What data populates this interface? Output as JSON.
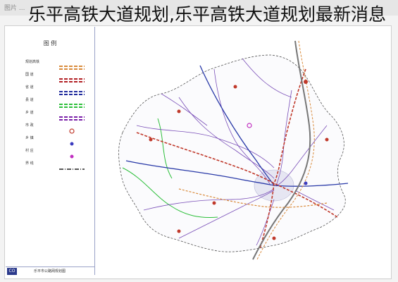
{
  "toolbar": {
    "text": "图片 ..."
  },
  "title": "乐平高铁大道规划,乐平高铁大道规划最新消息",
  "legend": {
    "title": "图 例",
    "items": [
      {
        "label": "规划高铁",
        "color": "#d98a3a",
        "pattern": "double-dash"
      },
      {
        "label": "国 道",
        "color": "#b21f24",
        "pattern": "double-dash"
      },
      {
        "label": "省 道",
        "color": "#1f2a9c",
        "pattern": "double-dash"
      },
      {
        "label": "县 道",
        "color": "#2cbf3a",
        "pattern": "double-dash"
      },
      {
        "label": "乡 道",
        "color": "#7a1fa8",
        "pattern": "double-dash"
      },
      {
        "label": "市 政",
        "color": "#c0392b",
        "pattern": "circle"
      },
      {
        "label": "乡 镇",
        "color": "#3b3bbf",
        "pattern": "dot"
      },
      {
        "label": "村 庄",
        "color": "#c02fc0",
        "pattern": "dot"
      },
      {
        "label": "界 线",
        "color": "#222222",
        "pattern": "dash"
      }
    ]
  },
  "footer": {
    "badge": "CO",
    "text": "乐平市公路网规划图"
  },
  "map": {
    "colors": {
      "railway": "#d98a3a",
      "national_road": "#c0392b",
      "provincial_road": "#2a3aa8",
      "county_road": "#2cbf3a",
      "township_road": "#7a4fb8",
      "boundary": "#555555",
      "urban": "#e6e6f2"
    }
  }
}
